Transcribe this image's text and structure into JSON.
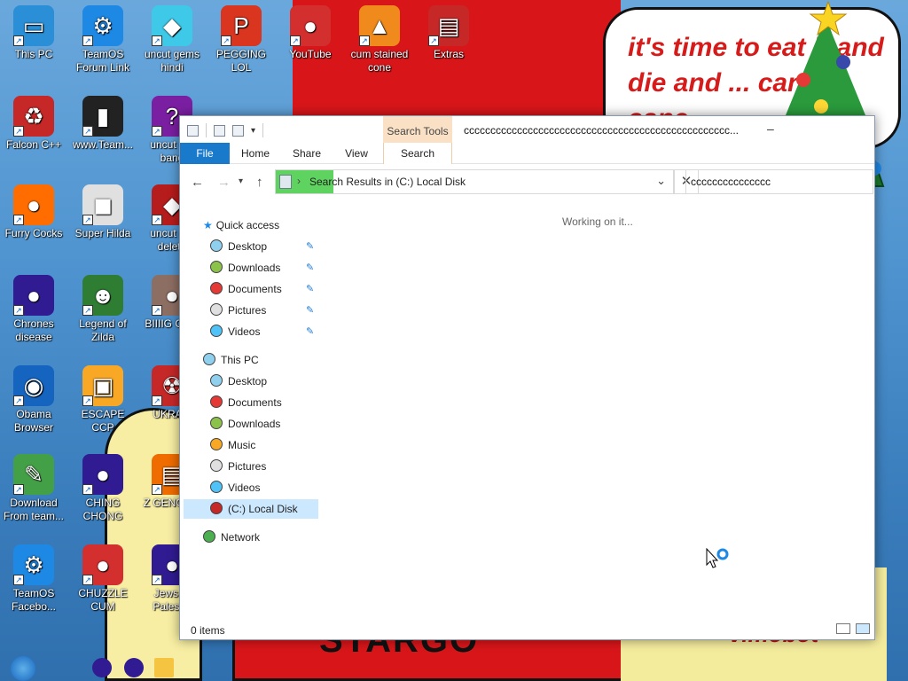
{
  "wallpaper": {
    "bubble_text": "it's time to eat it and die and ... candy cane",
    "bottom_text": "STARGO",
    "signature": "vimobot"
  },
  "desktop_icons": [
    {
      "label": "This PC",
      "glyph": "▭",
      "color": "#2a8fd6"
    },
    {
      "label": "TeamOS Forum Link",
      "glyph": "⚙",
      "color": "#1e88e5"
    },
    {
      "label": "uncut gems hindi",
      "glyph": "◆",
      "color": "#3ec9e8"
    },
    {
      "label": "PEGGING LOL",
      "glyph": "P",
      "color": "#d9351f"
    },
    {
      "label": "YouTube",
      "glyph": "●",
      "color": "#d32f2f"
    },
    {
      "label": "cum stained cone",
      "glyph": "▲",
      "color": "#f08a1c"
    },
    {
      "label": "Extras",
      "glyph": "▤",
      "color": "#c62828"
    },
    {
      "label": "Falcon C++",
      "glyph": "♻",
      "color": "#c62828"
    },
    {
      "label": "www.Team...",
      "glyph": "▮",
      "color": "#222222"
    },
    {
      "label": "uncut g... bang",
      "glyph": "?",
      "color": "#7b1fa2"
    },
    {
      "label": "Furry Cocks",
      "glyph": "●",
      "color": "#ff6d00"
    },
    {
      "label": "Super Hilda",
      "glyph": "◼",
      "color": "#e0e0e0"
    },
    {
      "label": "uncut g... delete",
      "glyph": "◆",
      "color": "#b71c1c"
    },
    {
      "label": "Chrones disease",
      "glyph": "●",
      "color": "#311b92"
    },
    {
      "label": "Legend of Zilda",
      "glyph": "☻",
      "color": "#2e7d32"
    },
    {
      "label": "BIIIIG CU...",
      "glyph": "●",
      "color": "#8d6e63"
    },
    {
      "label": "Obama Browser",
      "glyph": "◉",
      "color": "#1565c0"
    },
    {
      "label": "ESCAPE CCP",
      "glyph": "▣",
      "color": "#f9a825"
    },
    {
      "label": "UKRA...",
      "glyph": "☢",
      "color": "#c62828"
    },
    {
      "label": "Download From team...",
      "glyph": "✎",
      "color": "#43a047"
    },
    {
      "label": "CHING CHONG",
      "glyph": "●",
      "color": "#311b92"
    },
    {
      "label": "Z GENOC...",
      "glyph": "▤",
      "color": "#ef6c00"
    },
    {
      "label": "TeamOS Facebo...",
      "glyph": "⚙",
      "color": "#1e88e5"
    },
    {
      "label": "CHUZZLE CUM",
      "glyph": "●",
      "color": "#d32f2f"
    },
    {
      "label": "Jews In Palest...",
      "glyph": "●",
      "color": "#311b92"
    }
  ],
  "explorer": {
    "title": "cccccccccccccccccccccccccccccccccccccccccccccccccc...",
    "context_tab": "Search Tools",
    "ribbon_tabs": [
      "File",
      "Home",
      "Share",
      "View",
      "Search"
    ],
    "address": "Search Results in (C:) Local Disk",
    "search_value": "ccccccccccccccc",
    "working_message": "Working on it...",
    "nav": {
      "quick_access": "Quick access",
      "quick_items": [
        "Desktop",
        "Downloads",
        "Documents",
        "Pictures",
        "Videos"
      ],
      "this_pc": "This PC",
      "pc_items": [
        "Desktop",
        "Documents",
        "Downloads",
        "Music",
        "Pictures",
        "Videos",
        "(C:) Local Disk"
      ],
      "network": "Network"
    },
    "status": "0 items"
  }
}
